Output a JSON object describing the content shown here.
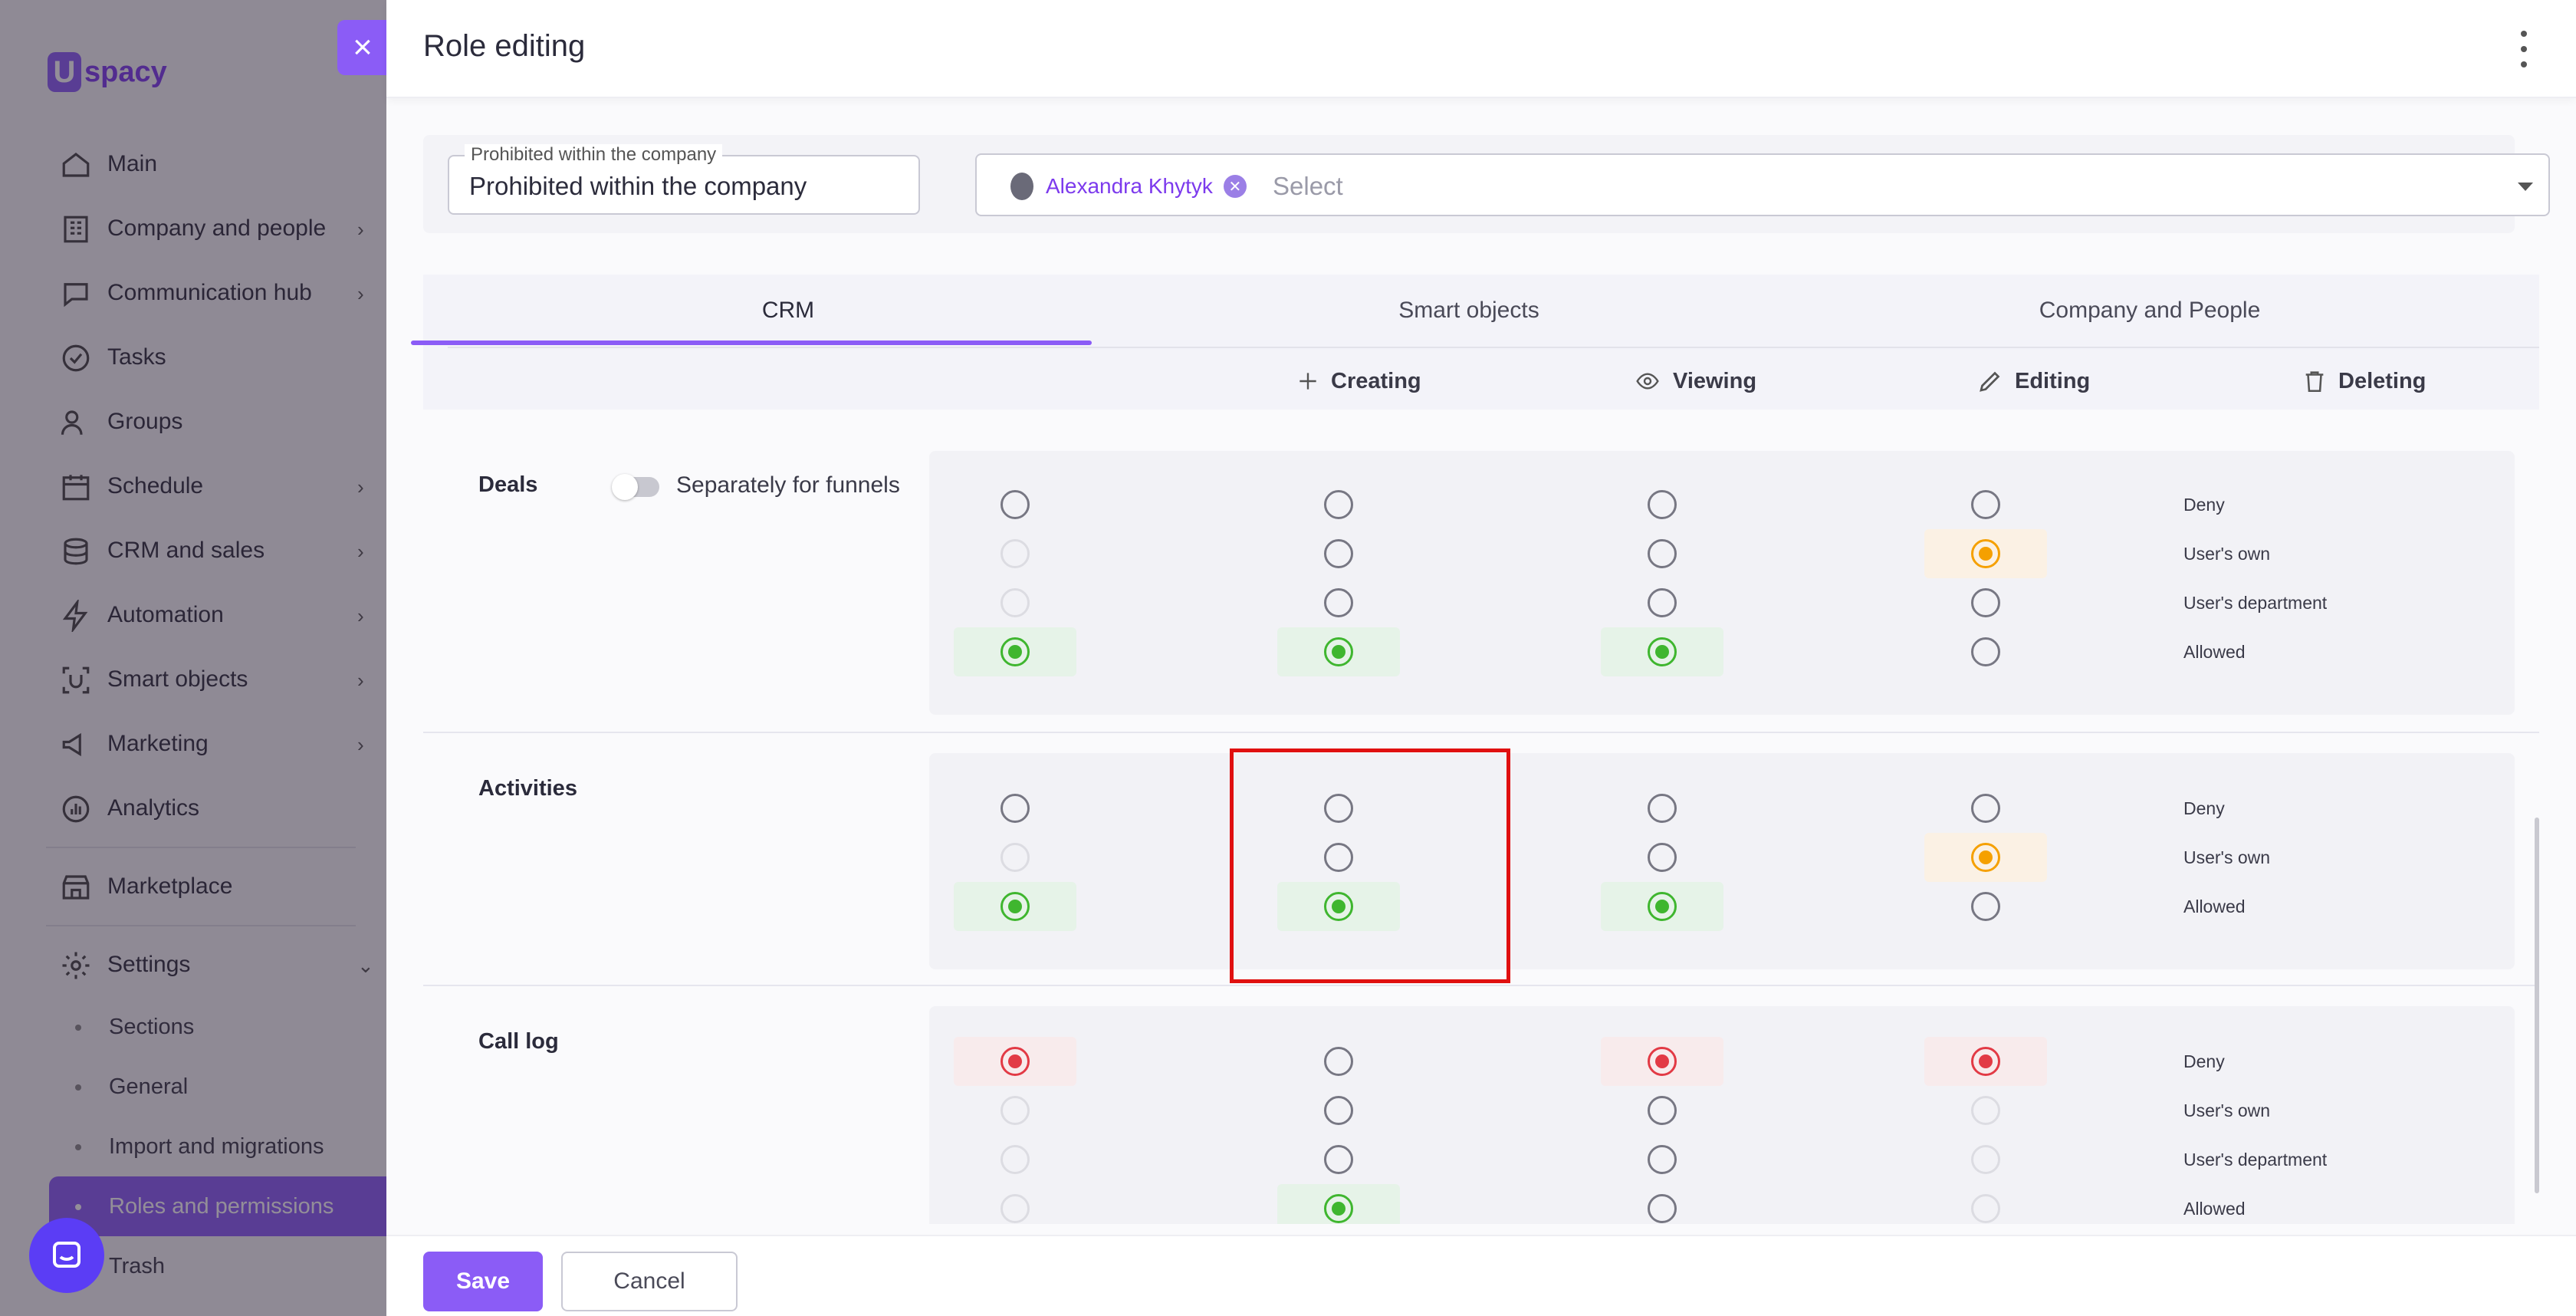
{
  "sidebar": {
    "logo_letter": "U",
    "logo_text": "spacy",
    "items": [
      {
        "label": "Main",
        "icon": "home-icon",
        "chevron": false
      },
      {
        "label": "Company and people",
        "icon": "building-icon",
        "chevron": true
      },
      {
        "label": "Communication hub",
        "icon": "chat-icon",
        "chevron": true
      },
      {
        "label": "Tasks",
        "icon": "check-circle-icon",
        "chevron": false
      },
      {
        "label": "Groups",
        "icon": "users-icon",
        "chevron": false
      },
      {
        "label": "Schedule",
        "icon": "calendar-icon",
        "chevron": true
      },
      {
        "label": "CRM and sales",
        "icon": "database-icon",
        "chevron": true
      },
      {
        "label": "Automation",
        "icon": "lightning-icon",
        "chevron": true
      },
      {
        "label": "Smart objects",
        "icon": "scan-icon",
        "chevron": true
      },
      {
        "label": "Marketing",
        "icon": "megaphone-icon",
        "chevron": true
      },
      {
        "label": "Analytics",
        "icon": "chart-icon",
        "chevron": false
      }
    ],
    "marketplace": "Marketplace",
    "settings": "Settings",
    "settings_sub": [
      "Sections",
      "General",
      "Import and migrations",
      "Roles and permissions",
      "Trash"
    ]
  },
  "panel": {
    "title": "Role editing",
    "filter": {
      "legend": "Prohibited within the company",
      "value": "Prohibited within the company",
      "chip_name": "Alexandra Khytyk",
      "select_placeholder": "Select"
    },
    "tabs": [
      "CRM",
      "Smart objects",
      "Company and People"
    ],
    "active_tab": "CRM",
    "columns": [
      "Creating",
      "Viewing",
      "Editing",
      "Deleting"
    ],
    "sections": [
      {
        "title": "Deals",
        "toggle_label": "Separately for funnels",
        "rows": [
          "Deny",
          "User's own",
          "User's department",
          "Allowed"
        ],
        "cells": [
          [
            "off",
            "off",
            "off",
            "off"
          ],
          [
            "disabled",
            "off",
            "off",
            "orange"
          ],
          [
            "disabled",
            "off",
            "off",
            "off"
          ],
          [
            "green",
            "green",
            "green",
            "off"
          ]
        ]
      },
      {
        "title": "Activities",
        "toggle_label": "",
        "rows": [
          "Deny",
          "User's own",
          "Allowed"
        ],
        "cells": [
          [
            "off",
            "off",
            "off",
            "off"
          ],
          [
            "disabled",
            "off",
            "off",
            "orange"
          ],
          [
            "green",
            "green",
            "green",
            "off"
          ]
        ]
      },
      {
        "title": "Call log",
        "toggle_label": "",
        "rows": [
          "Deny",
          "User's own",
          "User's department",
          "Allowed"
        ],
        "cells": [
          [
            "red",
            "off",
            "red",
            "red"
          ],
          [
            "disabled",
            "off",
            "off",
            "disabled"
          ],
          [
            "disabled",
            "off",
            "off",
            "disabled"
          ],
          [
            "disabled",
            "green",
            "off",
            "disabled"
          ]
        ]
      }
    ]
  },
  "footer": {
    "save_label": "Save",
    "cancel_label": "Cancel"
  },
  "colors": {
    "accent": "#8b5cf6",
    "allowed": "#3fb62f",
    "own": "#f5a000",
    "deny": "#e23a45"
  }
}
